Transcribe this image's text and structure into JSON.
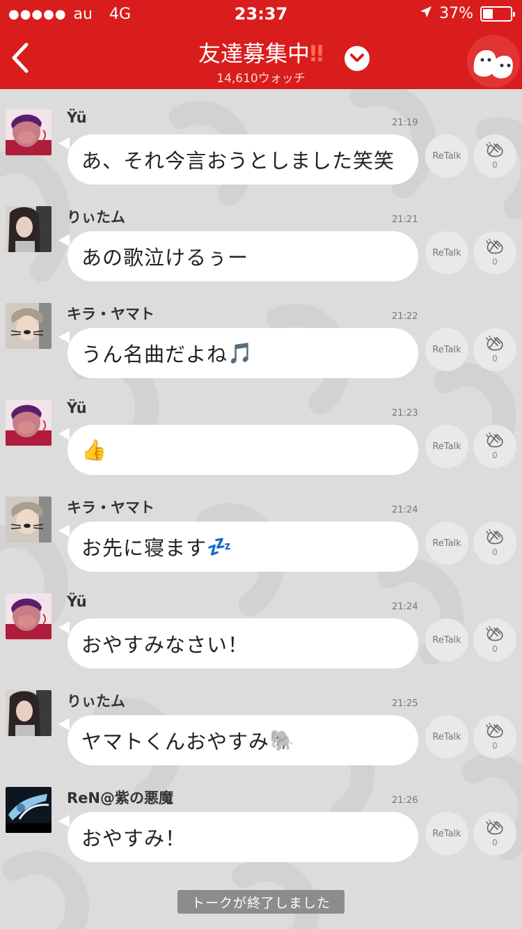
{
  "status_bar": {
    "signal": "●●●●●",
    "carrier": "au",
    "network": "4G",
    "time": "23:37",
    "battery_percent": "37%",
    "battery_level": 0.37
  },
  "header": {
    "title": "友達募集中",
    "title_emoji": "‼",
    "watch_count": "14,610ウォッチ"
  },
  "colors": {
    "header_bg": "#d91d1d",
    "bubble_bg": "#ffffff",
    "page_bg": "#dcdcdc"
  },
  "messages": [
    {
      "user": "Ÿü",
      "time": "21:19",
      "text": "あ、それ今言おうとしました笑笑",
      "emoji": "",
      "retalk": "ReTalk",
      "claps": "0"
    },
    {
      "user": "りぃたム",
      "time": "21:21",
      "text": "あの歌泣けるぅー",
      "emoji": "",
      "retalk": "ReTalk",
      "claps": "0"
    },
    {
      "user": "キラ・ヤマト",
      "time": "21:22",
      "text": "うん名曲だよね",
      "emoji": "🎵",
      "retalk": "ReTalk",
      "claps": "0"
    },
    {
      "user": "Ÿü",
      "time": "21:23",
      "text": "",
      "emoji": "👍",
      "retalk": "ReTalk",
      "claps": "0"
    },
    {
      "user": "キラ・ヤマト",
      "time": "21:24",
      "text": "お先に寝ます",
      "emoji": "💤",
      "retalk": "ReTalk",
      "claps": "0"
    },
    {
      "user": "Ÿü",
      "time": "21:24",
      "text": "おやすみなさい！",
      "emoji": "",
      "retalk": "ReTalk",
      "claps": "0"
    },
    {
      "user": "りぃたム",
      "time": "21:25",
      "text": "ヤマトくんおやすみ",
      "emoji": "🐘",
      "retalk": "ReTalk",
      "claps": "0"
    },
    {
      "user": "ReN@紫の悪魔",
      "time": "21:26",
      "text": "おやすみ！",
      "emoji": "",
      "retalk": "ReTalk",
      "claps": "0"
    }
  ],
  "footer": {
    "end_label": "トークが終了しました"
  }
}
